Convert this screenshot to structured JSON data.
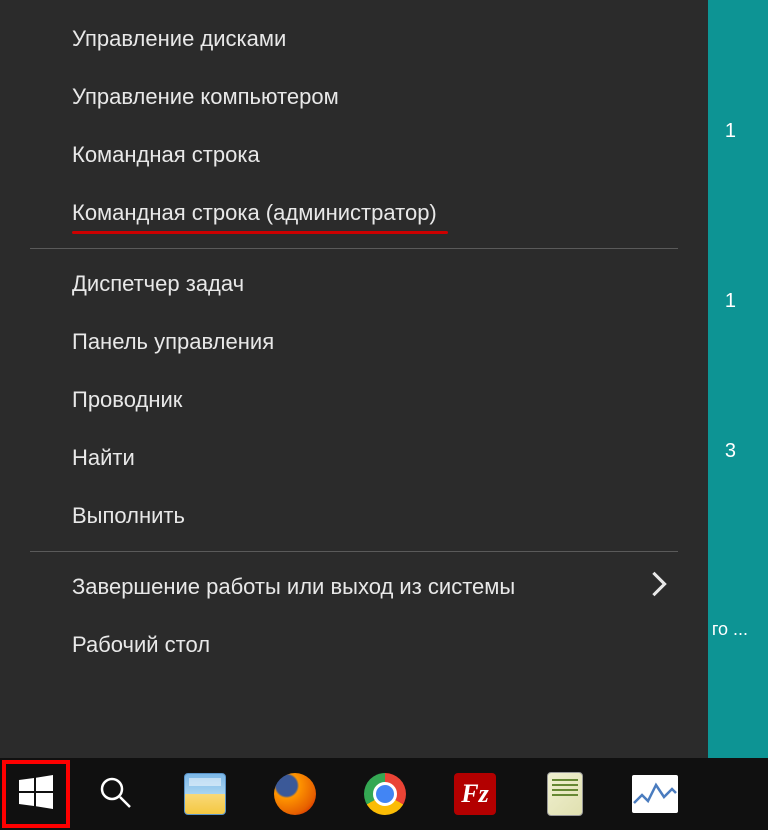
{
  "menu": {
    "items": [
      {
        "label": "Управление дисками",
        "highlighted": false,
        "hasSubmenu": false
      },
      {
        "label": "Управление компьютером",
        "highlighted": false,
        "hasSubmenu": false
      },
      {
        "label": "Командная строка",
        "highlighted": false,
        "hasSubmenu": false
      },
      {
        "label": "Командная строка (администратор)",
        "highlighted": true,
        "hasSubmenu": false
      }
    ],
    "items2": [
      {
        "label": "Диспетчер задач",
        "highlighted": false,
        "hasSubmenu": false
      },
      {
        "label": "Панель управления",
        "highlighted": false,
        "hasSubmenu": false
      },
      {
        "label": "Проводник",
        "highlighted": false,
        "hasSubmenu": false
      },
      {
        "label": "Найти",
        "highlighted": false,
        "hasSubmenu": false
      },
      {
        "label": "Выполнить",
        "highlighted": false,
        "hasSubmenu": false
      }
    ],
    "items3": [
      {
        "label": "Завершение работы или выход из системы",
        "highlighted": false,
        "hasSubmenu": true
      },
      {
        "label": "Рабочий стол",
        "highlighted": false,
        "hasSubmenu": false
      }
    ]
  },
  "taskbar": {
    "apps": [
      "start",
      "search",
      "explorer",
      "firefox",
      "chrome",
      "filezilla",
      "notepad",
      "monitor"
    ]
  },
  "desktop": {
    "fragments": [
      "1",
      "1",
      "3",
      "го\n..."
    ]
  }
}
